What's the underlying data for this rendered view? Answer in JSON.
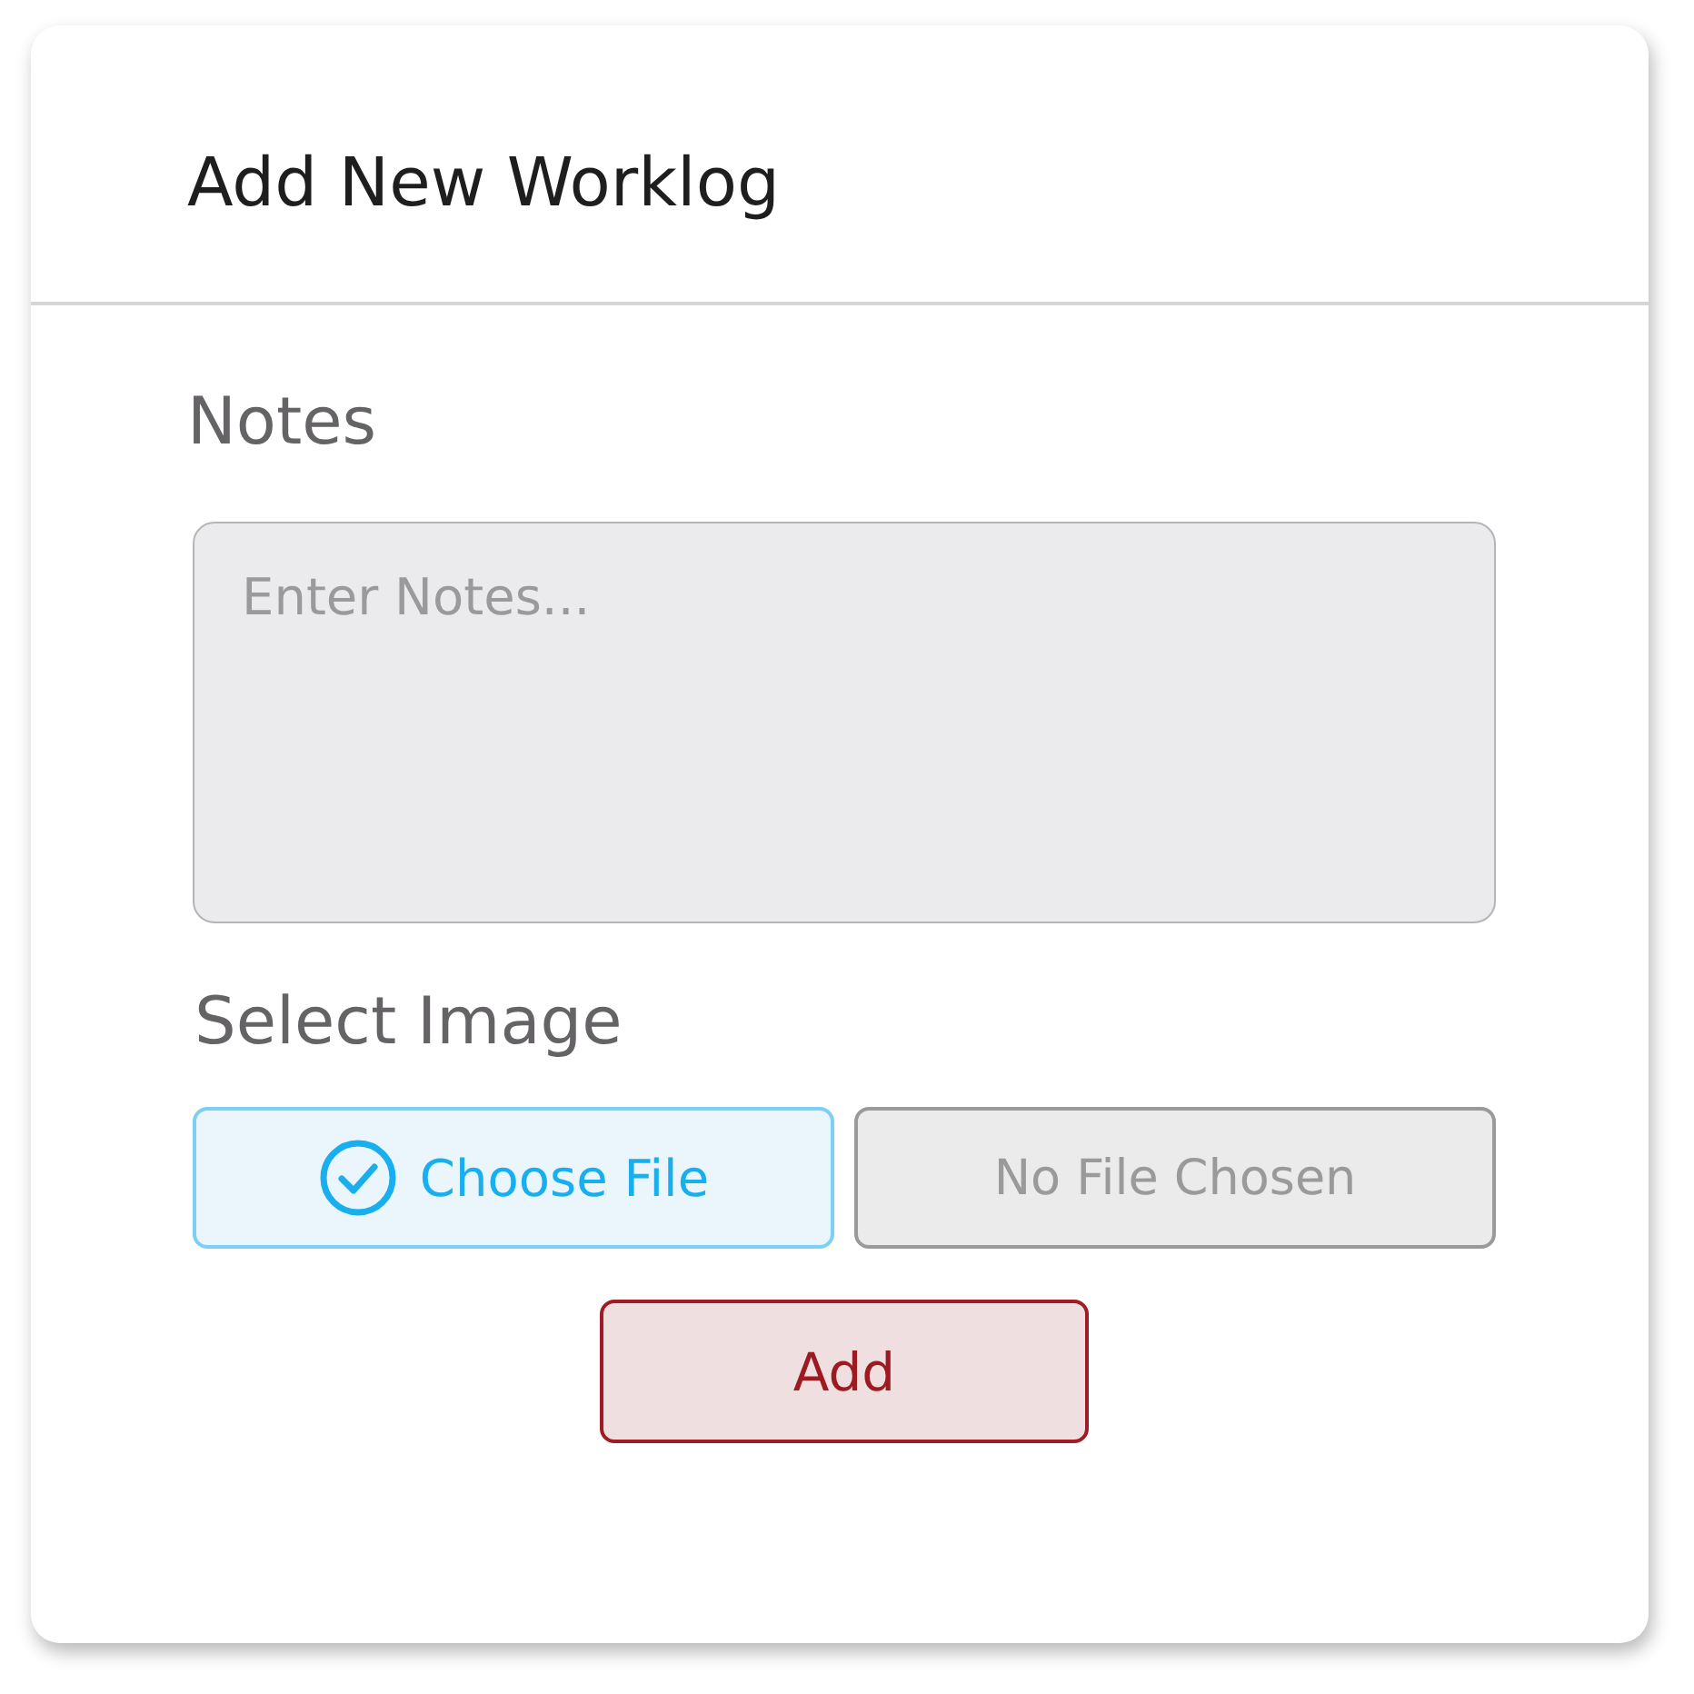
{
  "dialog": {
    "title": "Add New Worklog"
  },
  "notes": {
    "label": "Notes",
    "placeholder": "Enter Notes..."
  },
  "image": {
    "label": "Select Image",
    "choose_button": "Choose File",
    "file_status": "No File Chosen"
  },
  "add_button": "Add"
}
